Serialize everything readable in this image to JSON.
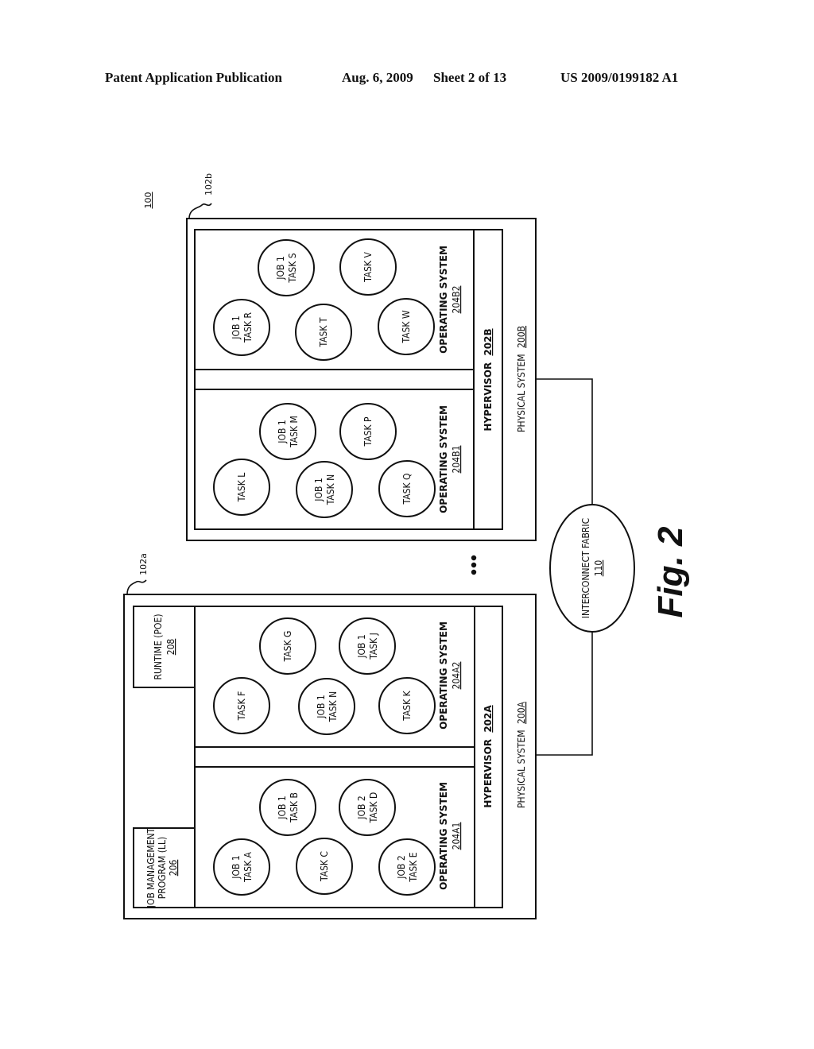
{
  "header": {
    "publication": "Patent Application Publication",
    "date": "Aug. 6, 2009",
    "sheet": "Sheet 2 of 13",
    "number": "US 2009/0199182 A1"
  },
  "figure": {
    "ref": "100",
    "caption": "Fig. 2",
    "ellipsis": "• • •",
    "interconnect": {
      "label": "INTERCONNECT FABRIC",
      "ref": "110"
    },
    "system_a": {
      "callout": "102a",
      "physical": {
        "label": "PHYSICAL SYSTEM",
        "ref": "200A"
      },
      "hypervisor": {
        "label": "HYPERVISOR",
        "ref": "202A"
      },
      "runtime": {
        "label": "RUNTIME (POE)",
        "ref": "208"
      },
      "job_mgmt": {
        "label1": "JOB MANAGEMENT",
        "label2": "PROGRAM (LL)",
        "ref": "206"
      },
      "os2": {
        "label": "OPERATING SYSTEM",
        "ref": "204A2",
        "tasks": [
          {
            "l1": "TASK F",
            "l2": ""
          },
          {
            "l1": "TASK G",
            "l2": ""
          },
          {
            "l1": "JOB 1",
            "l2": "TASK N"
          },
          {
            "l1": "JOB 1",
            "l2": "TASK J"
          },
          {
            "l1": "TASK K",
            "l2": ""
          }
        ]
      },
      "os1": {
        "label": "OPERATING SYSTEM",
        "ref": "204A1",
        "tasks": [
          {
            "l1": "JOB 1",
            "l2": "TASK A"
          },
          {
            "l1": "JOB 1",
            "l2": "TASK B"
          },
          {
            "l1": "TASK C",
            "l2": ""
          },
          {
            "l1": "JOB 2",
            "l2": "TASK D"
          },
          {
            "l1": "JOB 2",
            "l2": "TASK E"
          }
        ]
      }
    },
    "system_b": {
      "callout": "102b",
      "physical": {
        "label": "PHYSICAL SYSTEM",
        "ref": "200B"
      },
      "hypervisor": {
        "label": "HYPERVISOR",
        "ref": "202B"
      },
      "os2": {
        "label": "OPERATING SYSTEM",
        "ref": "204B2",
        "tasks": [
          {
            "l1": "JOB 1",
            "l2": "TASK R"
          },
          {
            "l1": "JOB 1",
            "l2": "TASK S"
          },
          {
            "l1": "TASK T",
            "l2": ""
          },
          {
            "l1": "TASK V",
            "l2": ""
          },
          {
            "l1": "TASK W",
            "l2": ""
          }
        ]
      },
      "os1": {
        "label": "OPERATING SYSTEM",
        "ref": "204B1",
        "tasks": [
          {
            "l1": "TASK L",
            "l2": ""
          },
          {
            "l1": "JOB 1",
            "l2": "TASK M"
          },
          {
            "l1": "JOB 1",
            "l2": "TASK N"
          },
          {
            "l1": "TASK P",
            "l2": ""
          },
          {
            "l1": "TASK Q",
            "l2": ""
          }
        ]
      }
    }
  }
}
